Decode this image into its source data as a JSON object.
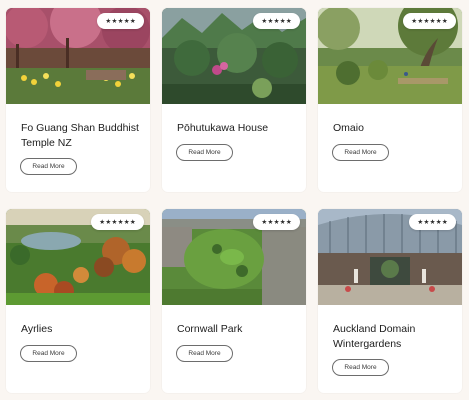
{
  "cards": [
    {
      "title": "Fo Guang Shan Buddhist Temple NZ",
      "rating": "★★★★★",
      "button": "Read More",
      "image": "temple-garden-photo"
    },
    {
      "title": "Pōhutukawa House",
      "rating": "★★★★★",
      "button": "Read More",
      "image": "glasshouse-plants-photo"
    },
    {
      "title": "Omaio",
      "rating": "★★★★★★",
      "button": "Read More",
      "image": "garden-tree-photo"
    },
    {
      "title": "Ayrlies",
      "rating": "★★★★★★",
      "button": "Read More",
      "image": "landscape-lake-photo"
    },
    {
      "title": "Cornwall Park",
      "rating": "★★★★★",
      "button": "Read More",
      "image": "aerial-park-photo"
    },
    {
      "title": "Auckland Domain Wintergardens",
      "rating": "★★★★★",
      "button": "Read More",
      "image": "wintergarden-photo"
    }
  ]
}
